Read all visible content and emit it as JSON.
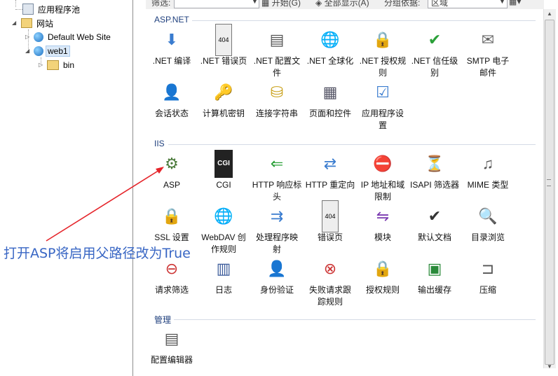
{
  "tree": {
    "app_pools": "应用程序池",
    "sites": "网站",
    "default_site": "Default Web Site",
    "web1": "web1",
    "bin": "bin"
  },
  "toolbar": {
    "filter_label": "筛选:",
    "start": "开始(G)",
    "show_all": "全部显示(A)",
    "group_by": "分组依据:",
    "group_value": "区域"
  },
  "sections": {
    "aspnet": {
      "title": "ASP.NET",
      "items": [
        {
          "l1": ".NET 编译",
          "l2": ""
        },
        {
          "l1": ".NET 错误页",
          "l2": ""
        },
        {
          "l1": ".NET 配置文",
          "l2": "件"
        },
        {
          "l1": ".NET 全球化",
          "l2": ""
        },
        {
          "l1": ".NET 授权规",
          "l2": "则"
        },
        {
          "l1": ".NET 信任级",
          "l2": "别"
        },
        {
          "l1": "SMTP 电子",
          "l2": "邮件"
        },
        {
          "l1": "会话状态",
          "l2": ""
        },
        {
          "l1": "计算机密钥",
          "l2": ""
        },
        {
          "l1": "连接字符串",
          "l2": ""
        },
        {
          "l1": "页面和控件",
          "l2": ""
        },
        {
          "l1": "应用程序设",
          "l2": "置"
        }
      ]
    },
    "iis": {
      "title": "IIS",
      "items": [
        {
          "l1": "ASP",
          "l2": ""
        },
        {
          "l1": "CGI",
          "l2": ""
        },
        {
          "l1": "HTTP 响应标",
          "l2": "头"
        },
        {
          "l1": "HTTP 重定向",
          "l2": ""
        },
        {
          "l1": "IP 地址和域",
          "l2": "限制"
        },
        {
          "l1": "ISAPI 筛选器",
          "l2": ""
        },
        {
          "l1": "MIME 类型",
          "l2": ""
        },
        {
          "l1": "SSL 设置",
          "l2": ""
        },
        {
          "l1": "WebDAV 创",
          "l2": "作规则"
        },
        {
          "l1": "处理程序映",
          "l2": "射"
        },
        {
          "l1": "错误页",
          "l2": ""
        },
        {
          "l1": "模块",
          "l2": ""
        },
        {
          "l1": "默认文档",
          "l2": ""
        },
        {
          "l1": "目录浏览",
          "l2": ""
        },
        {
          "l1": "请求筛选",
          "l2": ""
        },
        {
          "l1": "日志",
          "l2": ""
        },
        {
          "l1": "身份验证",
          "l2": ""
        },
        {
          "l1": "失败请求跟",
          "l2": "踪规则"
        },
        {
          "l1": "授权规则",
          "l2": ""
        },
        {
          "l1": "输出缓存",
          "l2": ""
        },
        {
          "l1": "压缩",
          "l2": ""
        }
      ]
    },
    "mgmt": {
      "title": "管理",
      "items": [
        {
          "l1": "配置编辑器",
          "l2": ""
        }
      ]
    }
  },
  "annotation": "打开ASP将启用父路径改为True"
}
